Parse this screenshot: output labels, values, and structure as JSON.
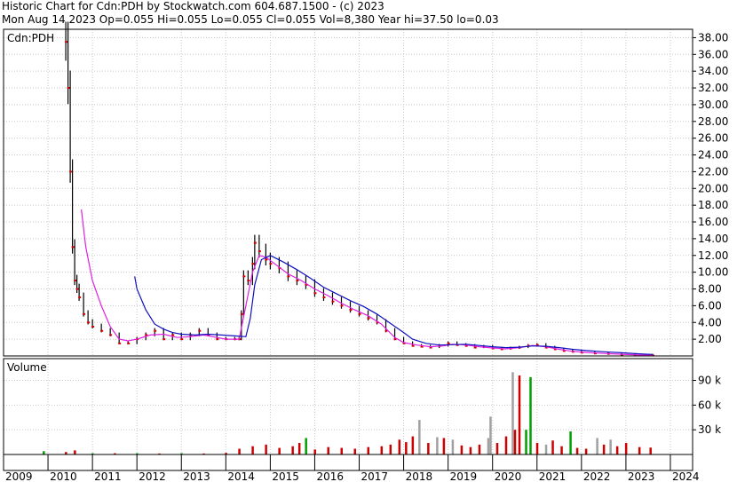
{
  "header": {
    "line1": "Historic Chart for Cdn:PDH by Stockwatch.com 604.687.1500 - (c) 2023",
    "line2": "Mon Aug 14 2023   Op=0.055  Hi=0.055  Lo=0.055  Cl=0.055  Vol=8,380   Year hi=37.50  lo=0.03"
  },
  "colors": {
    "price_bar": "#000000",
    "price_close": "#d40000",
    "ma_short": "#e020e0",
    "ma_long": "#1010c0",
    "vol_red": "#d00000",
    "vol_green": "#00a000",
    "vol_grey": "#a0a0a0",
    "grid": "#c8c8c8"
  },
  "chart_data": [
    {
      "type": "line",
      "panel": "price",
      "label": "Cdn:PDH",
      "ylim": [
        0,
        39
      ],
      "y_ticks": [
        "2.00",
        "4.00",
        "6.00",
        "8.00",
        "10.00",
        "12.00",
        "14.00",
        "16.00",
        "18.00",
        "20.00",
        "22.00",
        "24.00",
        "26.00",
        "28.00",
        "30.00",
        "32.00",
        "34.00",
        "36.00",
        "38.00"
      ],
      "x_ticks": [
        "2009",
        "2010",
        "2011",
        "2012",
        "2013",
        "2014",
        "2015",
        "2016",
        "2017",
        "2018",
        "2019",
        "2020",
        "2021",
        "2022",
        "2023",
        "2024"
      ],
      "x_range": [
        2009.0,
        2024.5
      ],
      "series": [
        {
          "role": "price",
          "points": [
            [
              2010.4,
              37.5
            ],
            [
              2010.45,
              32.0
            ],
            [
              2010.5,
              22.0
            ],
            [
              2010.55,
              13.0
            ],
            [
              2010.6,
              9.0
            ],
            [
              2010.65,
              8.0
            ],
            [
              2010.7,
              7.0
            ],
            [
              2010.8,
              5.0
            ],
            [
              2010.9,
              4.0
            ],
            [
              2011.0,
              3.5
            ],
            [
              2011.2,
              3.0
            ],
            [
              2011.4,
              2.5
            ],
            [
              2011.6,
              1.5
            ],
            [
              2011.8,
              1.5
            ],
            [
              2012.0,
              2.0
            ],
            [
              2012.2,
              2.5
            ],
            [
              2012.4,
              3.0
            ],
            [
              2012.6,
              2.0
            ],
            [
              2012.8,
              2.5
            ],
            [
              2013.0,
              2.0
            ],
            [
              2013.2,
              2.5
            ],
            [
              2013.4,
              3.0
            ],
            [
              2013.6,
              2.5
            ],
            [
              2013.8,
              2.0
            ],
            [
              2014.0,
              2.0
            ],
            [
              2014.2,
              2.0
            ],
            [
              2014.3,
              2.0
            ],
            [
              2014.35,
              5.0
            ],
            [
              2014.4,
              9.5
            ],
            [
              2014.5,
              9.0
            ],
            [
              2014.6,
              11.0
            ],
            [
              2014.65,
              13.5
            ],
            [
              2014.75,
              12.5
            ],
            [
              2014.9,
              11.5
            ],
            [
              2015.0,
              11.0
            ],
            [
              2015.2,
              10.5
            ],
            [
              2015.4,
              9.5
            ],
            [
              2015.6,
              9.0
            ],
            [
              2015.8,
              8.5
            ],
            [
              2016.0,
              7.5
            ],
            [
              2016.2,
              7.0
            ],
            [
              2016.4,
              6.5
            ],
            [
              2016.6,
              6.0
            ],
            [
              2016.8,
              5.5
            ],
            [
              2017.0,
              5.0
            ],
            [
              2017.2,
              4.5
            ],
            [
              2017.4,
              4.0
            ],
            [
              2017.6,
              3.0
            ],
            [
              2017.8,
              2.0
            ],
            [
              2018.0,
              1.5
            ],
            [
              2018.2,
              1.2
            ],
            [
              2018.4,
              1.1
            ],
            [
              2018.6,
              1.0
            ],
            [
              2018.8,
              1.2
            ],
            [
              2019.0,
              1.5
            ],
            [
              2019.2,
              1.3
            ],
            [
              2019.4,
              1.2
            ],
            [
              2019.6,
              1.0
            ],
            [
              2019.8,
              1.1
            ],
            [
              2020.0,
              0.9
            ],
            [
              2020.2,
              0.8
            ],
            [
              2020.4,
              0.9
            ],
            [
              2020.6,
              1.0
            ],
            [
              2020.8,
              1.2
            ],
            [
              2021.0,
              1.3
            ],
            [
              2021.2,
              1.0
            ],
            [
              2021.4,
              0.8
            ],
            [
              2021.6,
              0.6
            ],
            [
              2021.8,
              0.5
            ],
            [
              2022.0,
              0.4
            ],
            [
              2022.3,
              0.3
            ],
            [
              2022.6,
              0.25
            ],
            [
              2022.9,
              0.15
            ],
            [
              2023.2,
              0.1
            ],
            [
              2023.6,
              0.055
            ]
          ]
        },
        {
          "role": "ma_short",
          "points": [
            [
              2010.75,
              17.5
            ],
            [
              2010.85,
              13.0
            ],
            [
              2011.0,
              9.0
            ],
            [
              2011.2,
              6.0
            ],
            [
              2011.4,
              3.5
            ],
            [
              2011.6,
              2.0
            ],
            [
              2011.8,
              1.8
            ],
            [
              2012.0,
              2.0
            ],
            [
              2012.3,
              2.5
            ],
            [
              2012.6,
              2.6
            ],
            [
              2012.9,
              2.2
            ],
            [
              2013.2,
              2.3
            ],
            [
              2013.5,
              2.5
            ],
            [
              2013.8,
              2.2
            ],
            [
              2014.0,
              2.0
            ],
            [
              2014.3,
              2.0
            ],
            [
              2014.45,
              6.0
            ],
            [
              2014.6,
              10.0
            ],
            [
              2014.75,
              12.0
            ],
            [
              2014.9,
              11.8
            ],
            [
              2015.1,
              11.0
            ],
            [
              2015.4,
              9.8
            ],
            [
              2015.7,
              9.0
            ],
            [
              2016.0,
              8.0
            ],
            [
              2016.3,
              7.2
            ],
            [
              2016.6,
              6.3
            ],
            [
              2016.9,
              5.5
            ],
            [
              2017.2,
              4.8
            ],
            [
              2017.5,
              3.8
            ],
            [
              2017.8,
              2.2
            ],
            [
              2018.0,
              1.6
            ],
            [
              2018.3,
              1.3
            ],
            [
              2018.6,
              1.1
            ],
            [
              2018.9,
              1.2
            ],
            [
              2019.1,
              1.4
            ],
            [
              2019.4,
              1.3
            ],
            [
              2019.7,
              1.1
            ],
            [
              2020.0,
              0.95
            ],
            [
              2020.3,
              0.85
            ],
            [
              2020.6,
              1.0
            ],
            [
              2020.9,
              1.25
            ],
            [
              2021.2,
              1.1
            ],
            [
              2021.5,
              0.8
            ],
            [
              2021.8,
              0.55
            ],
            [
              2022.1,
              0.42
            ],
            [
              2022.5,
              0.3
            ],
            [
              2022.9,
              0.2
            ],
            [
              2023.3,
              0.12
            ],
            [
              2023.6,
              0.08
            ]
          ]
        },
        {
          "role": "ma_long",
          "points": [
            [
              2011.95,
              9.5
            ],
            [
              2012.0,
              8.0
            ],
            [
              2012.2,
              5.5
            ],
            [
              2012.4,
              3.8
            ],
            [
              2012.6,
              3.2
            ],
            [
              2012.8,
              2.8
            ],
            [
              2013.0,
              2.6
            ],
            [
              2013.3,
              2.5
            ],
            [
              2013.6,
              2.6
            ],
            [
              2013.9,
              2.5
            ],
            [
              2014.2,
              2.4
            ],
            [
              2014.45,
              2.3
            ],
            [
              2014.55,
              4.5
            ],
            [
              2014.65,
              8.5
            ],
            [
              2014.8,
              11.5
            ],
            [
              2015.0,
              12.0
            ],
            [
              2015.3,
              11.2
            ],
            [
              2015.6,
              10.3
            ],
            [
              2015.9,
              9.3
            ],
            [
              2016.2,
              8.2
            ],
            [
              2016.5,
              7.4
            ],
            [
              2016.8,
              6.6
            ],
            [
              2017.1,
              5.9
            ],
            [
              2017.4,
              5.0
            ],
            [
              2017.7,
              3.9
            ],
            [
              2018.0,
              2.8
            ],
            [
              2018.2,
              2.0
            ],
            [
              2018.5,
              1.5
            ],
            [
              2018.8,
              1.3
            ],
            [
              2019.1,
              1.35
            ],
            [
              2019.4,
              1.4
            ],
            [
              2019.7,
              1.25
            ],
            [
              2020.0,
              1.1
            ],
            [
              2020.3,
              1.0
            ],
            [
              2020.6,
              1.05
            ],
            [
              2020.9,
              1.2
            ],
            [
              2021.2,
              1.15
            ],
            [
              2021.5,
              1.0
            ],
            [
              2021.8,
              0.8
            ],
            [
              2022.1,
              0.65
            ],
            [
              2022.5,
              0.5
            ],
            [
              2022.9,
              0.38
            ],
            [
              2023.3,
              0.25
            ],
            [
              2023.6,
              0.18
            ]
          ]
        }
      ]
    },
    {
      "type": "bar",
      "panel": "volume",
      "label": "Volume",
      "ylim": [
        0,
        110000
      ],
      "y_ticks": [
        "30 k",
        "60 k",
        "90 k"
      ],
      "bars": [
        [
          2009.9,
          4000,
          "green"
        ],
        [
          2010.4,
          3000,
          "red"
        ],
        [
          2010.6,
          5000,
          "red"
        ],
        [
          2011.0,
          1500,
          "green"
        ],
        [
          2011.5,
          1500,
          "red"
        ],
        [
          2012.0,
          1500,
          "green"
        ],
        [
          2012.5,
          1200,
          "red"
        ],
        [
          2013.0,
          1500,
          "green"
        ],
        [
          2013.5,
          1200,
          "red"
        ],
        [
          2014.0,
          2000,
          "red"
        ],
        [
          2014.3,
          7000,
          "red"
        ],
        [
          2014.6,
          10000,
          "red"
        ],
        [
          2014.9,
          12000,
          "red"
        ],
        [
          2015.2,
          8000,
          "red"
        ],
        [
          2015.5,
          10000,
          "red"
        ],
        [
          2015.65,
          14000,
          "red"
        ],
        [
          2015.8,
          20000,
          "green"
        ],
        [
          2016.0,
          6000,
          "red"
        ],
        [
          2016.3,
          9000,
          "red"
        ],
        [
          2016.6,
          8000,
          "red"
        ],
        [
          2016.9,
          7000,
          "red"
        ],
        [
          2017.2,
          9000,
          "red"
        ],
        [
          2017.5,
          10000,
          "red"
        ],
        [
          2017.7,
          12000,
          "red"
        ],
        [
          2017.9,
          18000,
          "red"
        ],
        [
          2018.05,
          15000,
          "red"
        ],
        [
          2018.2,
          22000,
          "red"
        ],
        [
          2018.35,
          42000,
          "grey"
        ],
        [
          2018.55,
          14000,
          "red"
        ],
        [
          2018.75,
          21000,
          "grey"
        ],
        [
          2018.9,
          20000,
          "red"
        ],
        [
          2019.1,
          18000,
          "grey"
        ],
        [
          2019.3,
          11000,
          "red"
        ],
        [
          2019.5,
          9000,
          "red"
        ],
        [
          2019.7,
          12000,
          "red"
        ],
        [
          2019.9,
          20000,
          "grey"
        ],
        [
          2019.95,
          46000,
          "grey"
        ],
        [
          2020.1,
          14000,
          "red"
        ],
        [
          2020.3,
          22000,
          "red"
        ],
        [
          2020.45,
          100000,
          "grey"
        ],
        [
          2020.5,
          30000,
          "red"
        ],
        [
          2020.6,
          96000,
          "red"
        ],
        [
          2020.75,
          30000,
          "green"
        ],
        [
          2020.85,
          94000,
          "green"
        ],
        [
          2021.0,
          14000,
          "red"
        ],
        [
          2021.2,
          12000,
          "grey"
        ],
        [
          2021.35,
          17000,
          "red"
        ],
        [
          2021.55,
          10000,
          "red"
        ],
        [
          2021.75,
          28000,
          "green"
        ],
        [
          2021.9,
          8000,
          "red"
        ],
        [
          2022.1,
          7000,
          "red"
        ],
        [
          2022.35,
          20000,
          "grey"
        ],
        [
          2022.5,
          12000,
          "red"
        ],
        [
          2022.65,
          18000,
          "grey"
        ],
        [
          2022.8,
          10000,
          "red"
        ],
        [
          2023.0,
          14000,
          "red"
        ],
        [
          2023.3,
          9000,
          "red"
        ],
        [
          2023.55,
          8380,
          "red"
        ]
      ]
    }
  ]
}
